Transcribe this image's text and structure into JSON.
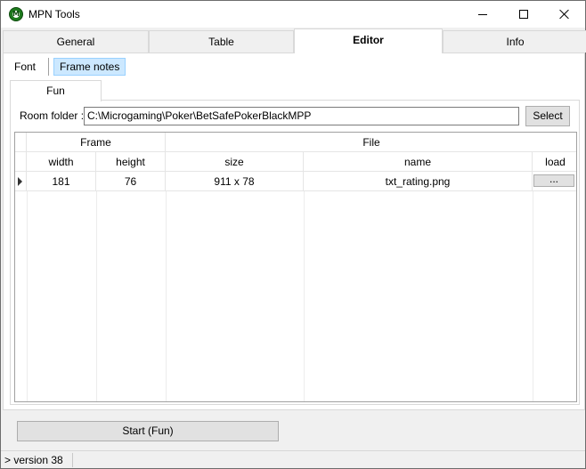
{
  "window": {
    "title": "MPN Tools",
    "icon_letter": "M"
  },
  "main_tabs": [
    {
      "label": "General",
      "active": false
    },
    {
      "label": "Table",
      "active": false
    },
    {
      "label": "Editor",
      "active": true
    },
    {
      "label": "Info",
      "active": false
    }
  ],
  "sub_toolbar": {
    "font_label": "Font",
    "frame_notes_label": "Frame notes"
  },
  "inner_tab": {
    "label": "Fun"
  },
  "room": {
    "label": "Room folder :",
    "path": "C:\\Microgaming\\Poker\\BetSafePokerBlackMPP",
    "select_label": "Select"
  },
  "grid": {
    "group_headers": {
      "frame": "Frame",
      "file": "File"
    },
    "columns": [
      "width",
      "height",
      "size",
      "name",
      "load"
    ],
    "rows": [
      {
        "width": "181",
        "height": "76",
        "size": "911 x 78",
        "name": "txt_rating.png",
        "load": "..."
      }
    ]
  },
  "start_button": {
    "label": "Start (Fun)"
  },
  "status": {
    "text": "> version 38"
  }
}
